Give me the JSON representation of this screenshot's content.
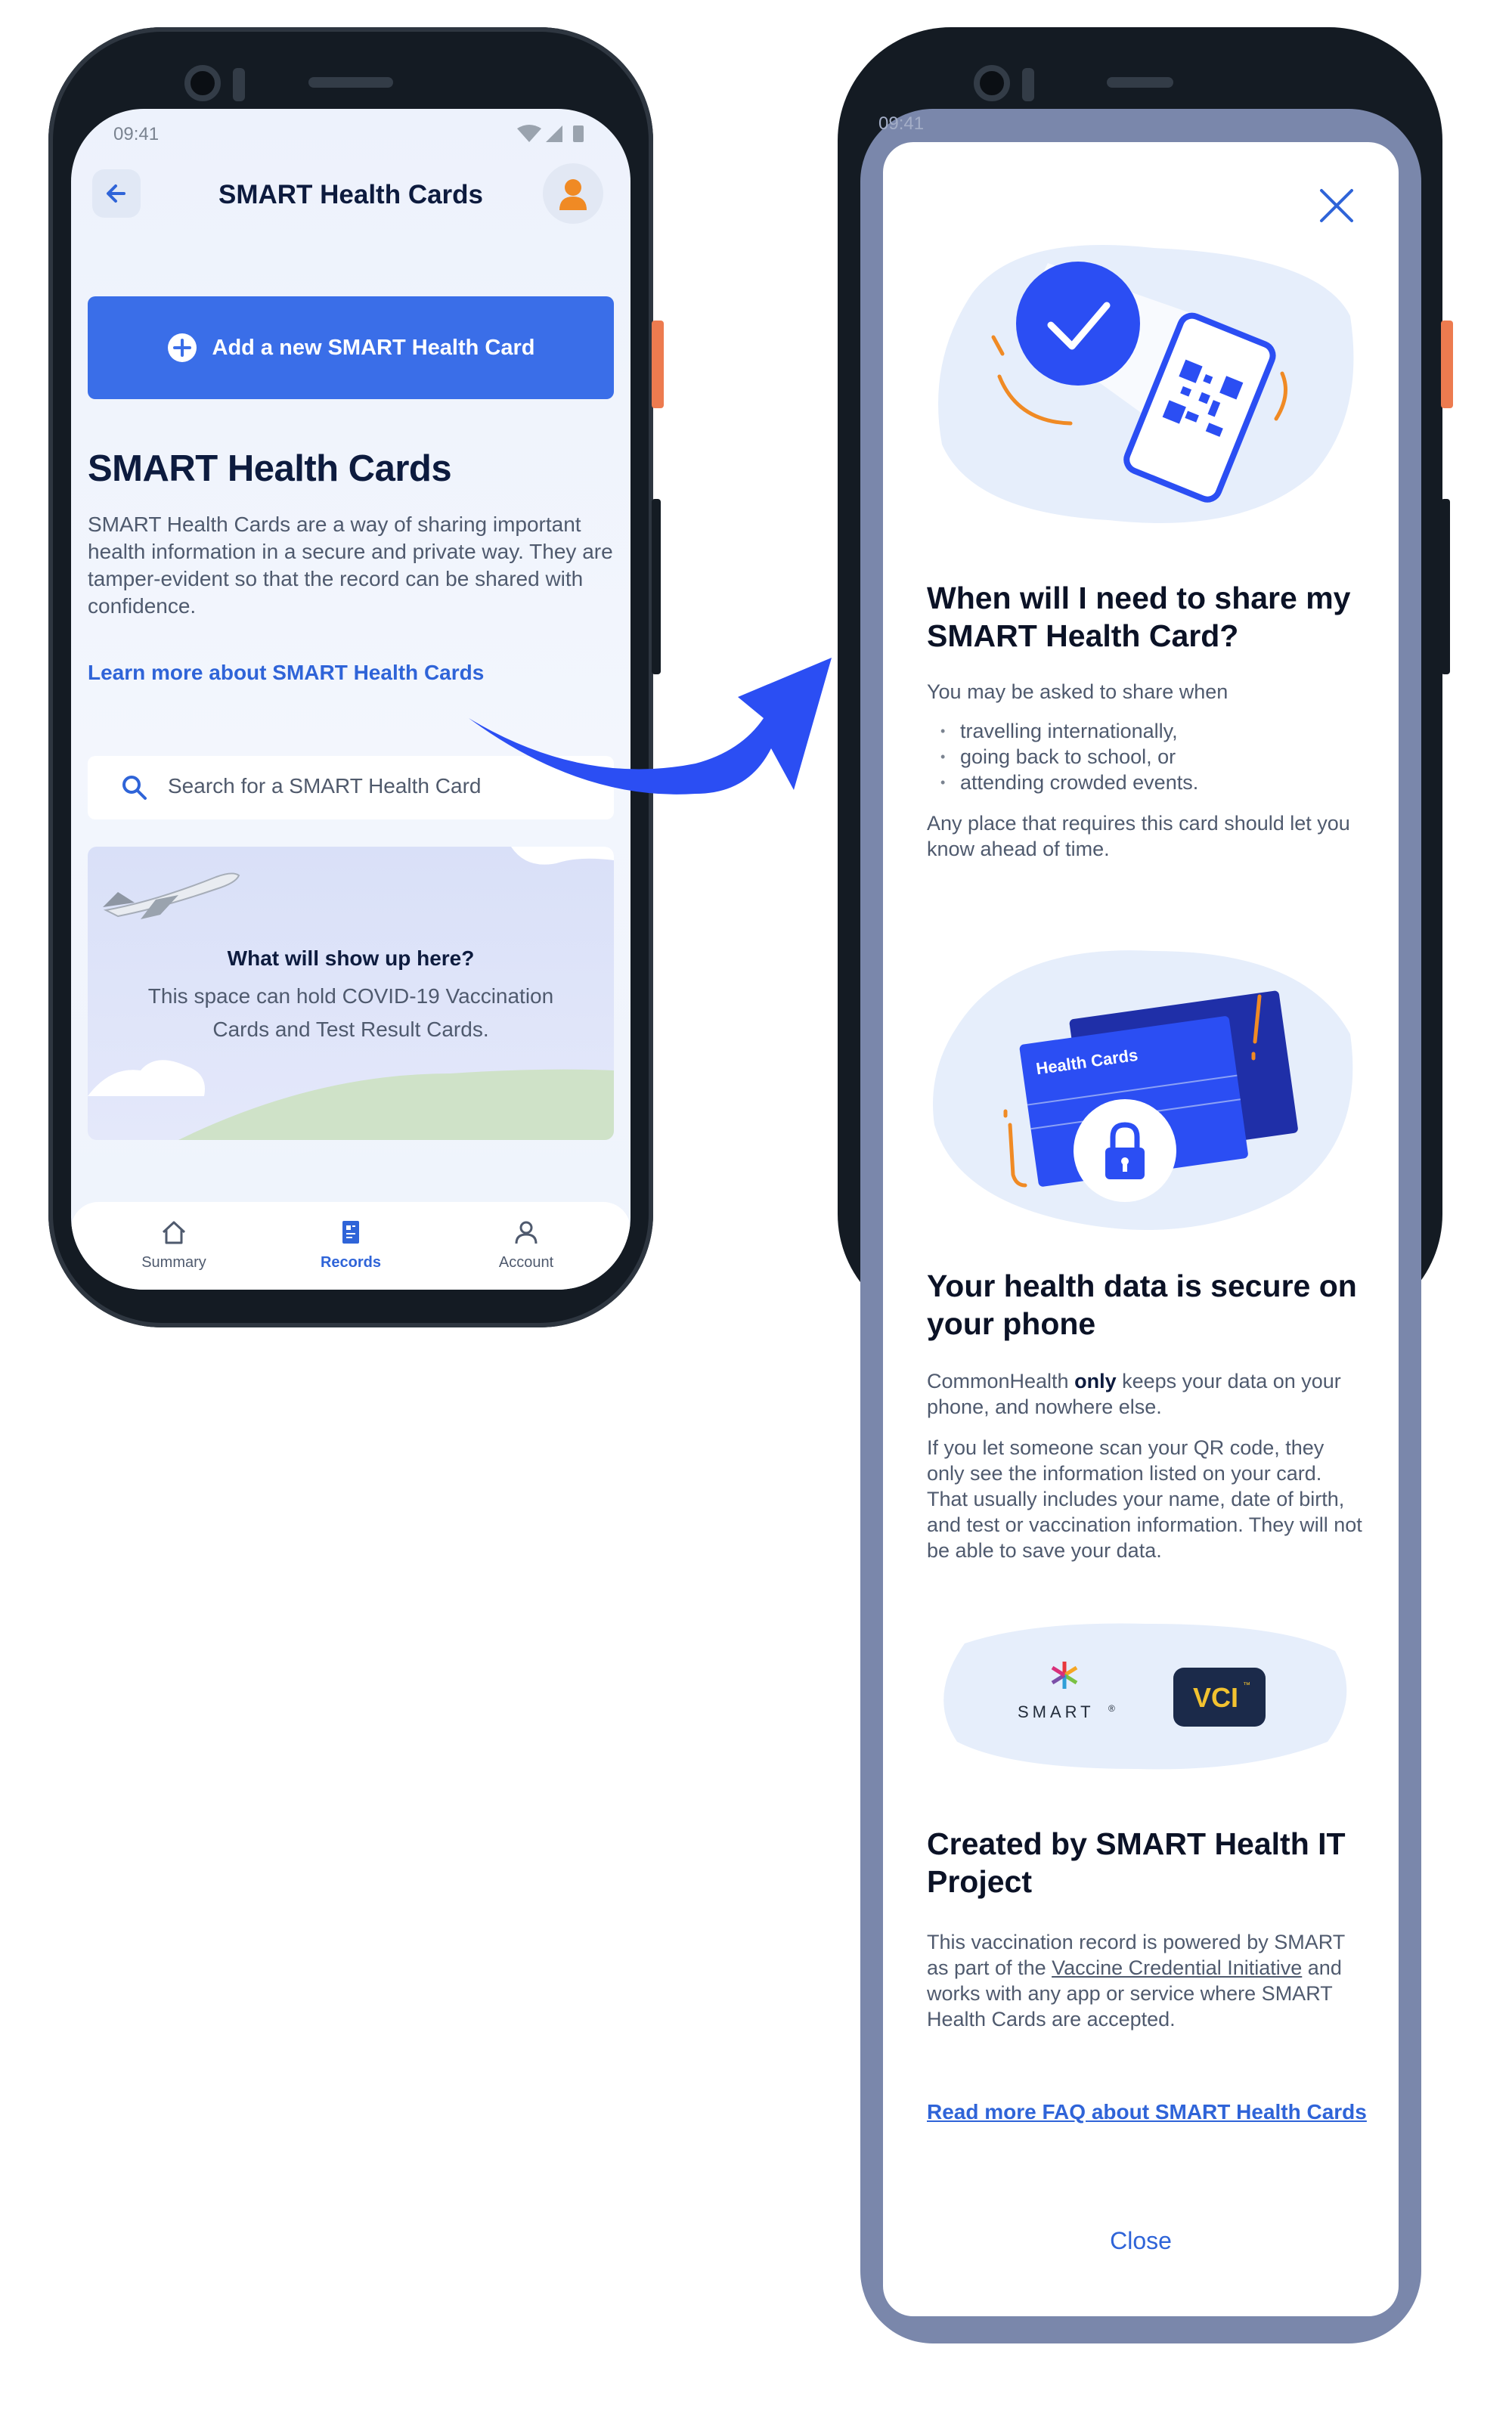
{
  "left_phone": {
    "status_time": "09:41",
    "header": {
      "title": "SMART Health Cards"
    },
    "add_button_label": "Add a new SMART Health Card",
    "section_title": "SMART Health Cards",
    "description": "SMART Health Cards are a way of sharing important health information in a secure and private way. They are tamper-evident so that the record can be shared with confidence.",
    "learn_more_link": "Learn more about SMART Health Cards",
    "search_placeholder": "Search for a SMART Health Card",
    "empty_state": {
      "title": "What will show up here?",
      "description": "This space can hold COVID-19 Vaccination Cards and Test Result Cards."
    },
    "bottom_nav": [
      {
        "label": "Summary",
        "icon": "home-icon",
        "active": false
      },
      {
        "label": "Records",
        "icon": "records-icon",
        "active": true
      },
      {
        "label": "Account",
        "icon": "account-icon",
        "active": false
      }
    ]
  },
  "right_phone": {
    "status_time": "09:41",
    "section1": {
      "title": "When will I need to share my SMART Health Card?",
      "intro": "You may be asked to share when",
      "bullets": [
        "travelling internationally,",
        "going back to school, or",
        "attending crowded events."
      ],
      "outro": "Any place that requires this card should let you know ahead of time."
    },
    "card_illustration_label": "Health Cards",
    "section2": {
      "title": "Your health data is secure on your phone",
      "para1_prefix": "CommonHealth ",
      "para1_bold": "only",
      "para1_suffix": " keeps your data on your phone, and nowhere else.",
      "para2": "If you let someone scan your QR code, they only see the information listed on your card. That usually includes your name, date of birth, and test or vaccination information. They will not be able to save your data."
    },
    "logos": {
      "smart_text": "SMART",
      "smart_mark": "®",
      "vci_text": "VCI",
      "vci_mark": "™"
    },
    "section3": {
      "title": "Created by SMART Health IT Project",
      "text_prefix": "This vaccination record is powered by SMART as part of the ",
      "link_text": "Vaccine Credential Initiative",
      "text_suffix": " and works with any app or service where SMART Health Cards are accepted."
    },
    "faq_link": "Read more FAQ about SMART Health Cards",
    "close_label": "Close"
  },
  "colors": {
    "primary": "#3a6ee8",
    "link": "#2f64d8",
    "avatar_orange": "#f08a24",
    "sheet_frame": "#7a87ab",
    "illustration_bg": "#e6eefb"
  }
}
